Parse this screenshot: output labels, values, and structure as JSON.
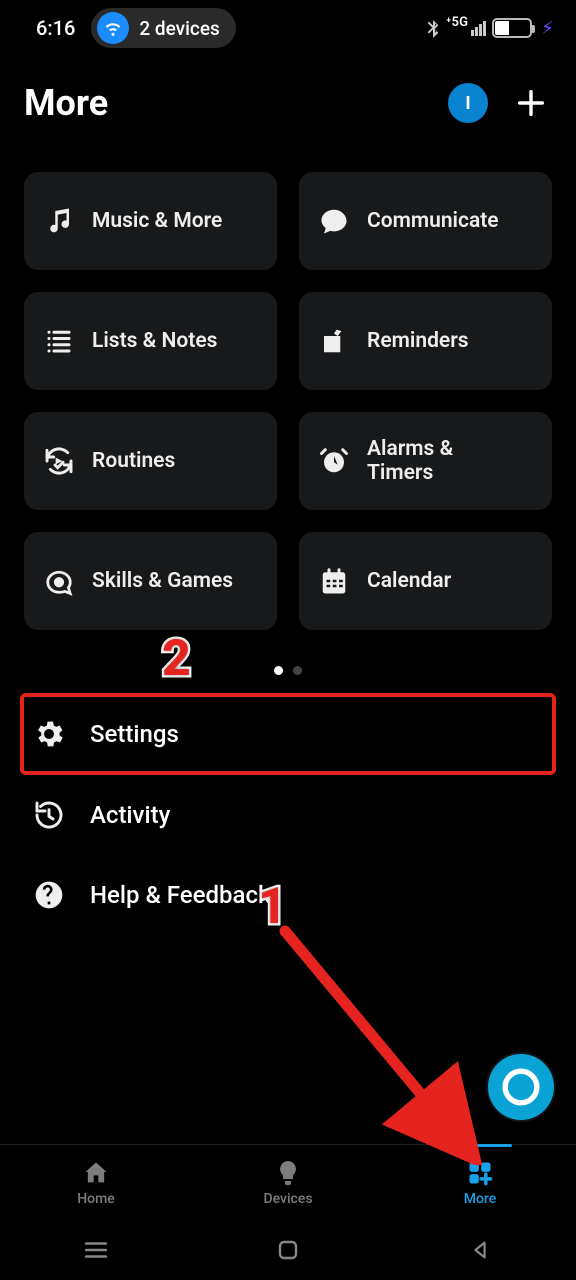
{
  "status": {
    "time": "6:16",
    "devices_label": "2 devices",
    "signal_text": "5G",
    "battery_pct": "38"
  },
  "header": {
    "title": "More",
    "avatar_initial": "I"
  },
  "cards": [
    {
      "label": "Music & More"
    },
    {
      "label": "Communicate"
    },
    {
      "label": "Lists & Notes"
    },
    {
      "label": "Reminders"
    },
    {
      "label": "Routines"
    },
    {
      "label": "Alarms &\nTimers"
    },
    {
      "label": "Skills & Games"
    },
    {
      "label": "Calendar"
    }
  ],
  "rows": {
    "settings": "Settings",
    "activity": "Activity",
    "help": "Help & Feedback"
  },
  "tabs": {
    "home": "Home",
    "devices": "Devices",
    "more": "More"
  },
  "annotations": {
    "step1": "1",
    "step2": "2",
    "highlight_row": "settings",
    "arrow_target_tab": "more"
  }
}
